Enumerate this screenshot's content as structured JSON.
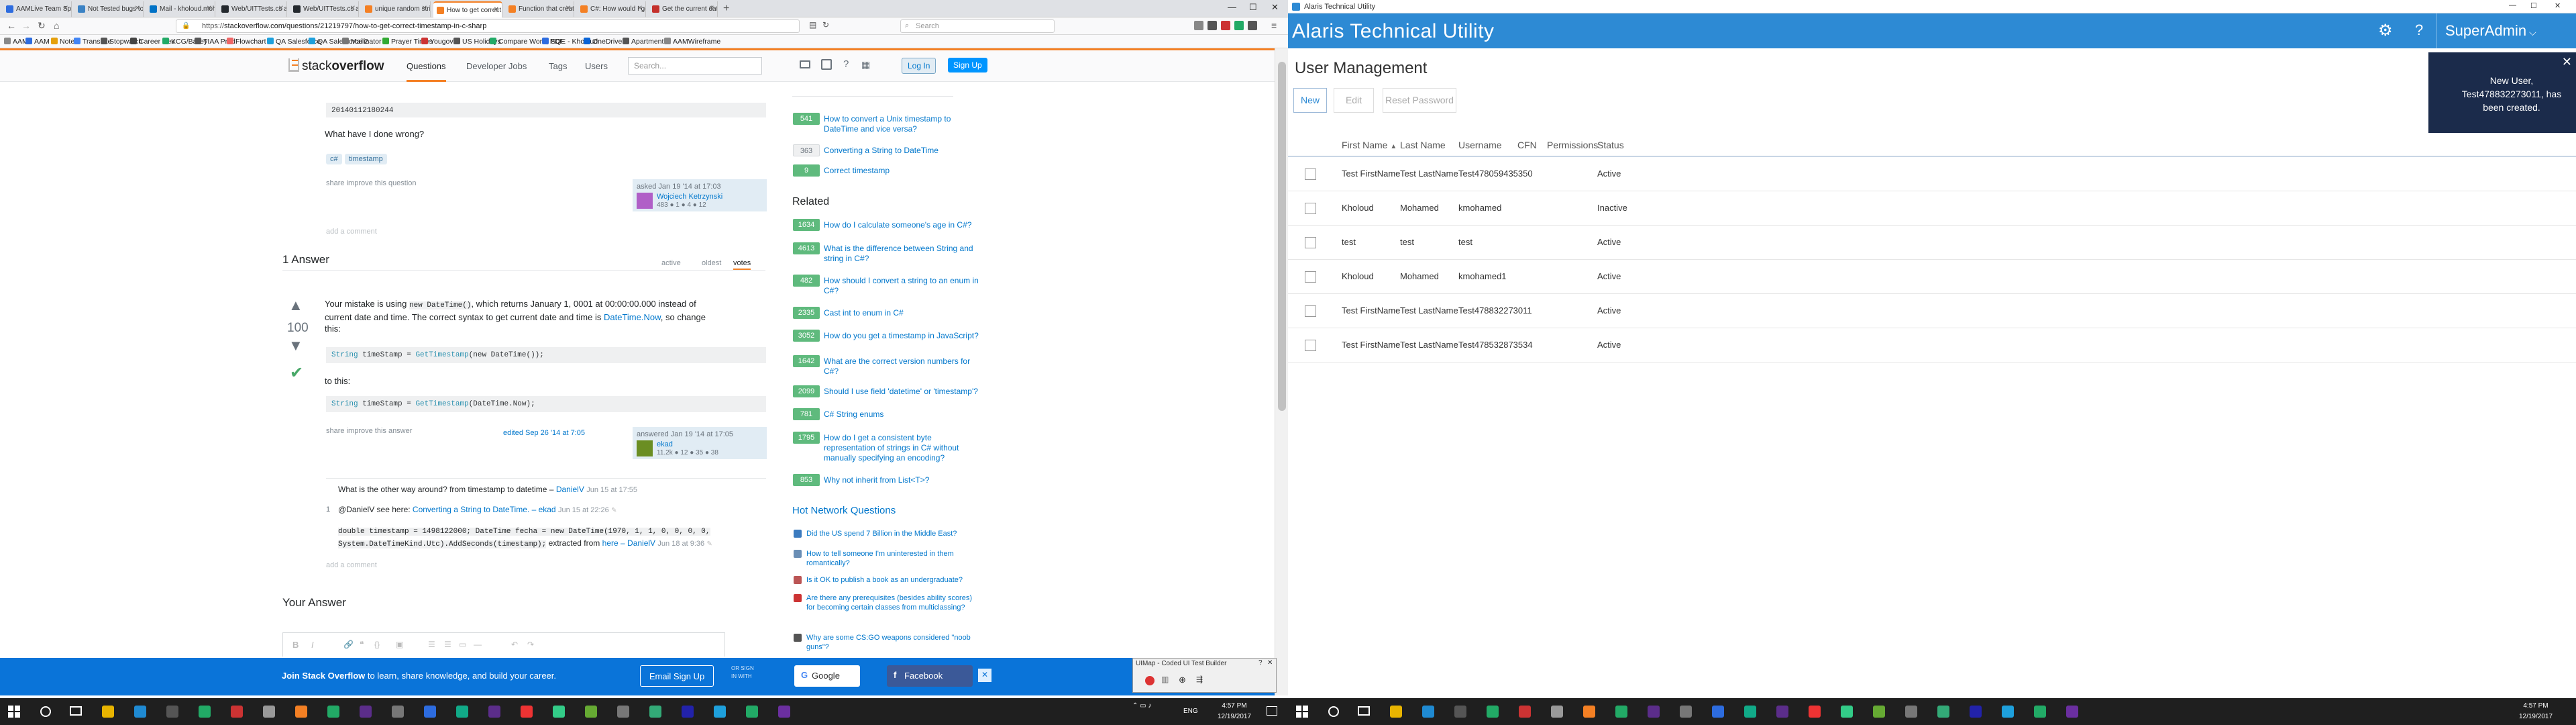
{
  "browser": {
    "tabs": [
      {
        "label": "AAMLive Team Sprin",
        "color": "#2d6cdf"
      },
      {
        "label": "Not Tested bugs too",
        "color": "#3b82c4"
      },
      {
        "label": "Mail - kholoud.moh",
        "color": "#0072c6"
      },
      {
        "label": "Web/UITTests.cs at",
        "color": "#24292e"
      },
      {
        "label": "Web/UITTests.cs at",
        "color": "#24292e"
      },
      {
        "label": "unique random strin",
        "color": "#f48024"
      },
      {
        "label": "How to get correct t",
        "color": "#f48024"
      },
      {
        "label": "Function that creat",
        "color": "#f48024"
      },
      {
        "label": "C#: How would I ge",
        "color": "#f48024"
      },
      {
        "label": "Get the current date",
        "color": "#c4302b"
      }
    ],
    "url_prefix": "https://",
    "url": "stackoverflow.com/questions/21219797/how-to-get-correct-timestamp-in-c-sharp",
    "search_placeholder": "Search",
    "bookmarks": [
      {
        "label": "AAM",
        "color": "#888"
      },
      {
        "label": "AAM",
        "color": "#2d6cdf"
      },
      {
        "label": "Notes",
        "color": "#e5a00d"
      },
      {
        "label": "Translate",
        "color": "#4285f4"
      },
      {
        "label": "Stopwatch",
        "color": "#555"
      },
      {
        "label": "Career Dev",
        "color": "#444"
      },
      {
        "label": "KCG/Bailey",
        "color": "#2a6"
      },
      {
        "label": "TIAA Prod",
        "color": "#555"
      },
      {
        "label": "Flowchart",
        "color": "#e66"
      },
      {
        "label": "QA Salesforce",
        "color": "#1ea0dc"
      },
      {
        "label": "QA Salesforce 2",
        "color": "#1ea0dc"
      },
      {
        "label": "Mailinator",
        "color": "#777"
      },
      {
        "label": "Prayer Times",
        "color": "#3a3"
      },
      {
        "label": "Yougov",
        "color": "#c33"
      },
      {
        "label": "US Holidays",
        "color": "#555"
      },
      {
        "label": "Compare Word, PDF",
        "color": "#2a6"
      },
      {
        "label": "SQE - Kholoud",
        "color": "#2d6cdf"
      },
      {
        "label": "OneDrive",
        "color": "#0a64d6"
      },
      {
        "label": "Apartment",
        "color": "#555"
      },
      {
        "label": "AAMWireframe",
        "color": "#888"
      }
    ]
  },
  "so": {
    "logo_light": "stack",
    "logo_bold": "overflow",
    "nav": [
      "Questions",
      "Developer Jobs",
      "Tags",
      "Users"
    ],
    "search_placeholder": "Search...",
    "login": "Log In",
    "signup": "Sign Up",
    "question": {
      "code_snippet": "20140112180244",
      "what_done": "What have I done wrong?",
      "tags": [
        "c#",
        "timestamp"
      ],
      "share": "share",
      "improve": "improve this question",
      "asked": "asked Jan 19 '14 at 17:03",
      "asker": "Wojciech Ketrzynski",
      "asker_rep": "483 ● 1 ● 4 ● 12",
      "add_comment": "add a comment"
    },
    "answers_header": "1 Answer",
    "sort_tabs": [
      "active",
      "oldest",
      "votes"
    ],
    "answer": {
      "votes": "100",
      "p1_a": "Your mistake is using",
      "p1_code": "new DateTime()",
      "p1_b": ", which returns January 1, 0001 at 00:00:00.000 instead of",
      "p1_c": "current date and time. The correct syntax to get current date and time is",
      "p1_link": "DateTime.Now",
      "p1_d": ", so change",
      "p1_e": "this:",
      "code1_type": "String",
      "code1_var": " timeStamp = ",
      "code1_fn": "GetTimestamp",
      "code1_rest": "(new DateTime());",
      "to_this": "to this:",
      "code2_type": "String",
      "code2_var": " timeStamp = ",
      "code2_fn": "GetTimestamp",
      "code2_rest": "(DateTime.Now);",
      "share": "share",
      "improve": "improve this answer",
      "edited": "edited Sep 26 '14 at 7:05",
      "answered": "answered Jan 19 '14 at 17:05",
      "answerer": "ekad",
      "answerer_rep": "11.2k ● 12 ● 35 ● 38"
    },
    "comments": [
      {
        "text": "What is the other way around? from timestamp to datetime –",
        "user": "DanielV",
        "date": "Jun 15 at 17:55"
      },
      {
        "text": "@DanielV see here:",
        "link": "Converting a String to DateTime.",
        "user": "– ekad",
        "date": "Jun 15 at 22:26"
      },
      {
        "code_a": "double timestamp = 1498122000; DateTime fecha = new DateTime(1970, 1, 1, 0, 0, 0, 0,",
        "code_b": "System.DateTimeKind.Utc).AddSeconds(timestamp);",
        "tail": "extracted from",
        "link": "here",
        "user": "– DanielV",
        "date": "Jun 18 at 9:36"
      }
    ],
    "comment_votes": "1",
    "add_comment2": "add a comment",
    "your_answer": "Your Answer",
    "linked": [
      {
        "count": "541",
        "text": "How to convert a Unix timestamp to DateTime and vice versa?"
      },
      {
        "count": "363",
        "text": "Converting a String to DateTime"
      },
      {
        "count": "9",
        "text": "Correct timestamp"
      }
    ],
    "related_title": "Related",
    "related": [
      {
        "count": "1634",
        "text": "How do I calculate someone's age in C#?"
      },
      {
        "count": "4613",
        "text": "What is the difference between String and string in C#?"
      },
      {
        "count": "482",
        "text": "How should I convert a string to an enum in C#?"
      },
      {
        "count": "2335",
        "text": "Cast int to enum in C#"
      },
      {
        "count": "3052",
        "text": "How do you get a timestamp in JavaScript?"
      },
      {
        "count": "1642",
        "text": "What are the correct version numbers for C#?"
      },
      {
        "count": "2099",
        "text": "Should I use field 'datetime' or 'timestamp'?"
      },
      {
        "count": "781",
        "text": "C# String enums"
      },
      {
        "count": "1795",
        "text": "How do I get a consistent byte representation of strings in C# without manually specifying an encoding?"
      },
      {
        "count": "853",
        "text": "Why not inherit from List<T>?"
      }
    ],
    "hot_title": "Hot Network Questions",
    "hot": [
      {
        "text": "Did the US spend 7 Billion in the Middle East?",
        "color": "#3b7bbf"
      },
      {
        "text": "How to tell someone I'm uninterested in them romantically?",
        "color": "#6a8eb5"
      },
      {
        "text": "Is it OK to publish a book as an undergraduate?",
        "color": "#b55"
      },
      {
        "text": "Are there any prerequisites (besides ability scores) for becoming certain classes from multiclassing?",
        "color": "#c33"
      },
      {
        "text": "Why are some CS:GO weapons considered \"noob guns\"?",
        "color": "#555"
      }
    ],
    "banner": {
      "lead": "Join Stack Overflow",
      "rest": " to learn, share knowledge, and build your career.",
      "email": "Email Sign Up",
      "or": "OR SIGN IN WITH",
      "google": "Google",
      "facebook": "Facebook"
    }
  },
  "uimap": {
    "title": "UIMap - Coded UI Test Builder"
  },
  "taskbar_left": {
    "time": "4:57 PM",
    "date": "12/19/2017",
    "lang": "ENG"
  },
  "taskbar_right": {
    "time": "4:57 PM",
    "date": "12/19/2017"
  },
  "alaris": {
    "window_title": "Alaris Technical Utility",
    "app_title": "Alaris Technical Utility",
    "user": "SuperAdmin",
    "page_title": "User Management",
    "buttons": {
      "new": "New",
      "edit": "Edit",
      "reset": "Reset Password"
    },
    "toast": "New User, Test478832273011, has been created.",
    "columns": [
      "First Name",
      "Last Name",
      "Username",
      "CFN",
      "Permissions",
      "Status"
    ],
    "rows": [
      {
        "first": "Test FirstName",
        "last": "Test LastName",
        "username": "Test478059435350",
        "cfn": "",
        "perm": "",
        "status": "Active"
      },
      {
        "first": "Kholoud",
        "last": "Mohamed",
        "username": "kmohamed",
        "cfn": "",
        "perm": "",
        "status": "Inactive"
      },
      {
        "first": "test",
        "last": "test",
        "username": "test",
        "cfn": "",
        "perm": "",
        "status": "Active"
      },
      {
        "first": "Kholoud",
        "last": "Mohamed",
        "username": "kmohamed1",
        "cfn": "",
        "perm": "",
        "status": "Active"
      },
      {
        "first": "Test FirstName",
        "last": "Test LastName",
        "username": "Test478832273011",
        "cfn": "",
        "perm": "",
        "status": "Active"
      },
      {
        "first": "Test FirstName",
        "last": "Test LastName",
        "username": "Test478532873534",
        "cfn": "",
        "perm": "",
        "status": "Active"
      }
    ]
  }
}
